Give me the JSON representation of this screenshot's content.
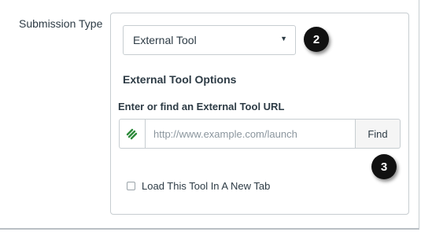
{
  "submission_type": {
    "label": "Submission Type",
    "selected": "External Tool"
  },
  "external_tool_options": {
    "heading": "External Tool Options",
    "url_label": "Enter or find an External Tool URL",
    "url_value": "",
    "url_placeholder": "http://www.example.com/launch",
    "find_label": "Find",
    "new_tab_label": "Load This Tool In A New Tab",
    "new_tab_checked": false
  },
  "callouts": [
    "2",
    "3"
  ],
  "icons": {
    "select_caret": "chevron-down-icon",
    "tool_addon": "external-tool-icon"
  },
  "colors": {
    "tool_icon": "#2e8b3c",
    "text": "#2d3b45",
    "border": "#c7cdd1",
    "callout_bg": "#111111"
  }
}
